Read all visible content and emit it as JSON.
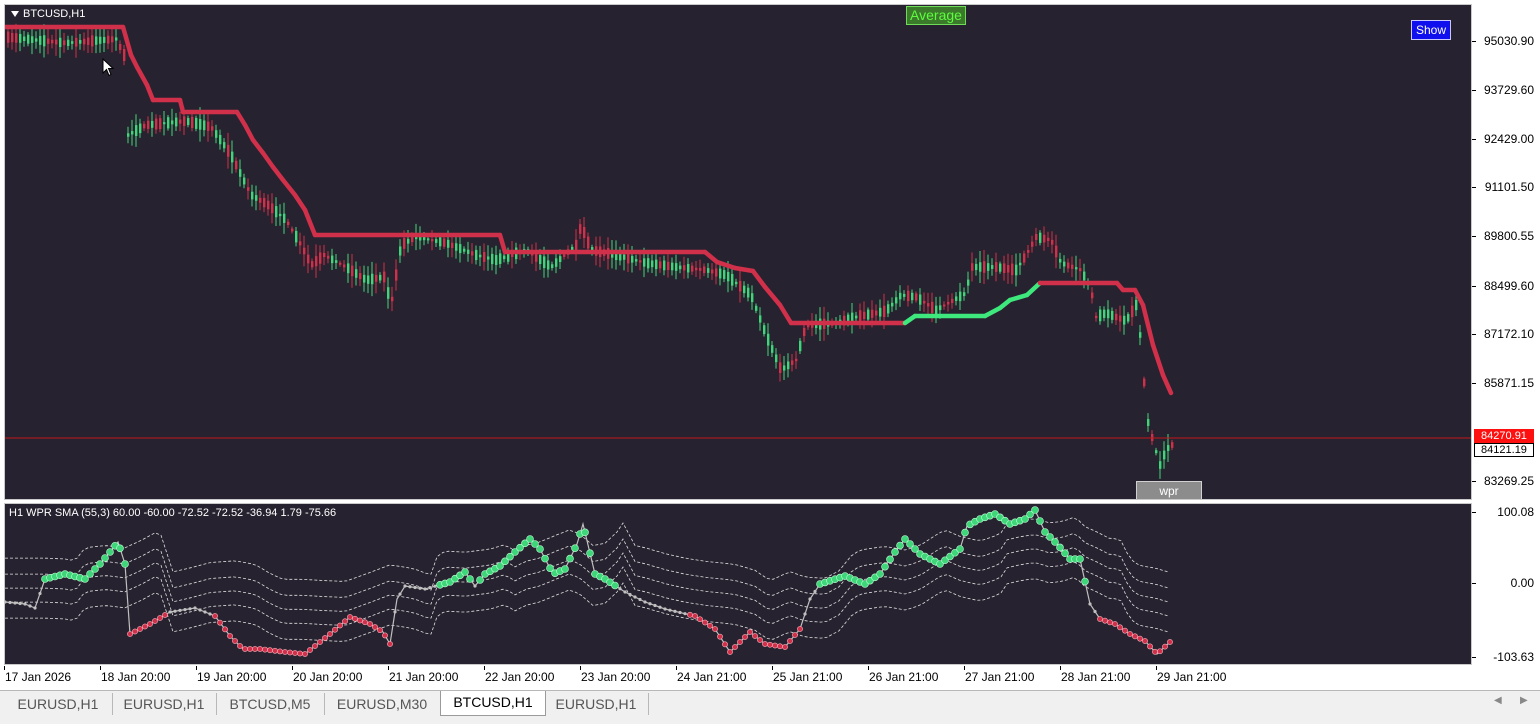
{
  "window": {
    "symbol_title": "BTCUSD,H1"
  },
  "main": {
    "average_label": "Average",
    "show_button": "Show",
    "wpr_button": "wpr",
    "price_ticks": [
      "95030.90",
      "93729.60",
      "92429.00",
      "91101.50",
      "89800.55",
      "88499.60",
      "87172.10",
      "85871.15",
      "84121.19",
      "83269.25"
    ],
    "price_tag_red": "84270.91",
    "price_tag_white": "84121.19"
  },
  "sub": {
    "title": "H1 WPR  SMA (55,3) 60.00 -60.00 -72.52 -72.52 -36.94 1.79 -75.66",
    "ticks": [
      "100.08",
      "0.00",
      "-103.63"
    ]
  },
  "time_axis": [
    "17 Jan 2026",
    "18 Jan 20:00",
    "19 Jan 20:00",
    "20 Jan 20:00",
    "21 Jan 20:00",
    "22 Jan 20:00",
    "23 Jan 20:00",
    "24 Jan 21:00",
    "25 Jan 21:00",
    "26 Jan 21:00",
    "27 Jan 21:00",
    "28 Jan 21:00",
    "29 Jan 21:00"
  ],
  "tabs": [
    {
      "label": "EURUSD,H1",
      "active": false
    },
    {
      "label": "EURUSD,H1",
      "active": false
    },
    {
      "label": "BTCUSD,M5",
      "active": false
    },
    {
      "label": "EURUSD,M30",
      "active": false
    },
    {
      "label": "BTCUSD,H1",
      "active": true
    },
    {
      "label": "EURUSD,H1",
      "active": false
    }
  ],
  "colors": {
    "background": "#27222f",
    "bull": "#3fd67a",
    "bear": "#d0304a",
    "stair_bear": "#d0304a",
    "stair_bull": "#3ee87d",
    "price_line": "#c01818"
  },
  "icons": {
    "cursor": "mouse-pointer-icon",
    "scroll_left": "scroll-left-icon",
    "scroll_right": "scroll-right-icon",
    "menu": "triangle-down-icon"
  }
}
